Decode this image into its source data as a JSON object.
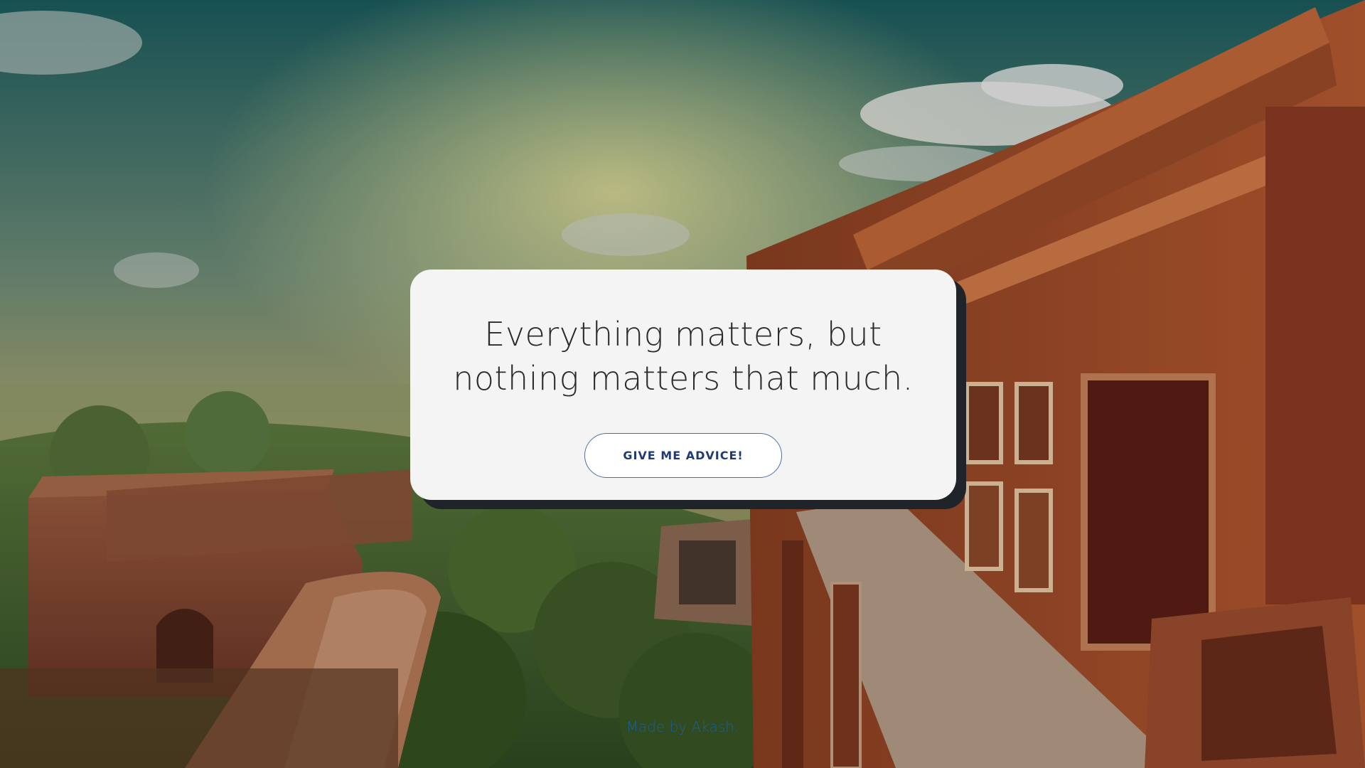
{
  "quote": {
    "text": "Everything matters, but nothing matters that much."
  },
  "button": {
    "label": "GIVE ME ADVICE!"
  },
  "footer": {
    "prefix": "Made by ",
    "author": "Akash",
    "suffix": "."
  },
  "colors": {
    "card_background": "#f4f4f4",
    "card_shadow": "#1f242b",
    "button_border": "#4c6fa8",
    "button_text": "#1f3a75",
    "footer_text": "#1b5f8f"
  }
}
